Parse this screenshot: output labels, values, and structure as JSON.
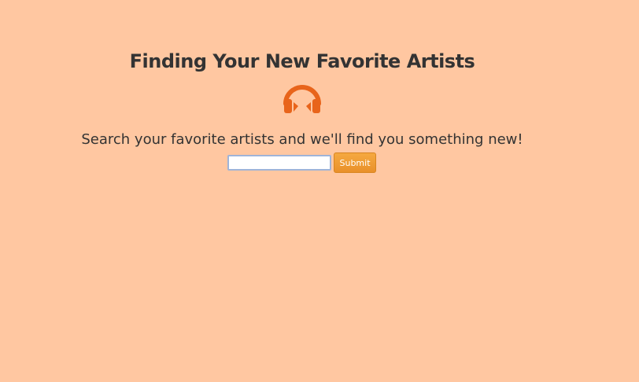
{
  "header": {
    "title": "Finding Your New Favorite Artists",
    "icon": "headphones-icon",
    "icon_color": "#e8641b"
  },
  "main": {
    "subtitle": "Search your favorite artists and we'll find you something new!"
  },
  "search": {
    "value": "",
    "placeholder": "",
    "submit_label": "Submit",
    "button_color": "#f0a035"
  },
  "page": {
    "background_color": "#ffc7a1"
  }
}
